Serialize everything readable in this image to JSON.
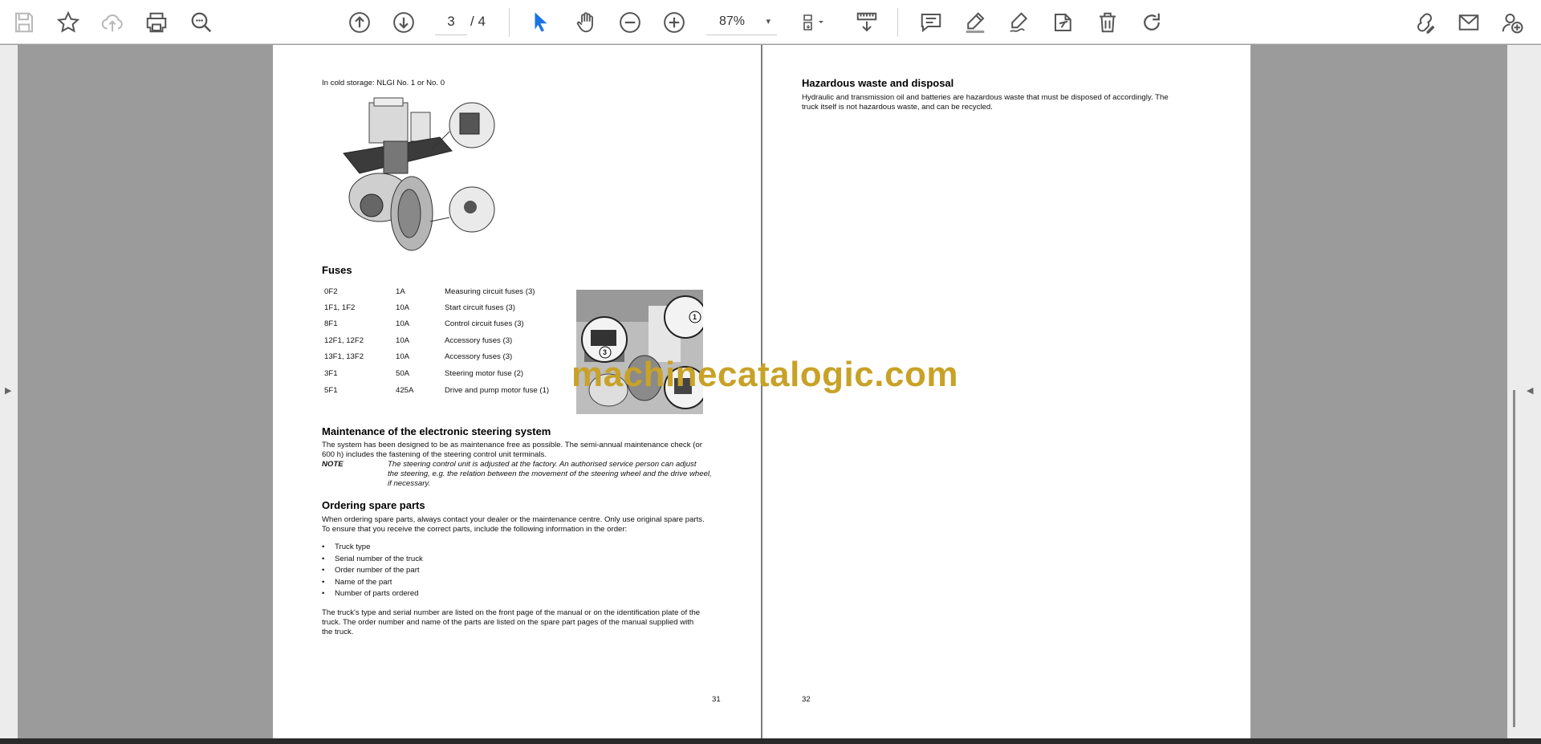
{
  "toolbar": {
    "page_current": "3",
    "page_total": "/ 4",
    "zoom": "87%",
    "zoom_caret": "▾"
  },
  "page_left": {
    "lubricant_line": "In cold storage: NLGI No. 1 or No. 0",
    "fuses_heading": "Fuses",
    "fuses": [
      [
        "0F2",
        "1A",
        "Measuring circuit fuses (3)"
      ],
      [
        "1F1, 1F2",
        "10A",
        "Start circuit fuses (3)"
      ],
      [
        "8F1",
        "10A",
        "Control circuit fuses (3)"
      ],
      [
        "12F1, 12F2",
        "10A",
        "Accessory fuses (3)"
      ],
      [
        "13F1, 13F2",
        "10A",
        "Accessory fuses (3)"
      ],
      [
        "3F1",
        "50A",
        "Steering motor fuse (2)"
      ],
      [
        "5F1",
        "425A",
        "Drive and pump motor fuse (1)"
      ]
    ],
    "callouts": [
      "1",
      "3"
    ],
    "steering_heading": "Maintenance of the electronic steering system",
    "steering_text_1": "The system has been designed to be as maintenance free as possible. The semi-annual maintenance check (or",
    "steering_text_2": "600 h) includes the fastening of the steering control unit terminals.",
    "note_label": "NOTE",
    "note_1": "The steering control unit is adjusted at the factory. An authorised service person can adjust",
    "note_2": "the steering, e.g. the relation between the movement of the steering wheel and the drive wheel,",
    "note_3": "if necessary.",
    "spare_heading": "Ordering spare parts",
    "spare_text_1": "When ordering spare parts, always contact your dealer or the maintenance centre. Only use original spare parts.",
    "spare_text_2": "To ensure that you receive the correct parts, include the following information in the order:",
    "bullet": "•",
    "bullets": [
      "Truck type",
      "Serial number of the truck",
      "Order number of the part",
      "Name of the part",
      "Number of parts ordered"
    ],
    "closing_1": "The truck's type and serial number are listed on the front page of the manual or on the identification plate of the",
    "closing_2": "truck. The order number and name of the parts are listed on the spare part pages of the manual supplied with",
    "closing_3": "the truck.",
    "page_number": "31"
  },
  "page_right": {
    "heading": "Hazardous waste and disposal",
    "text_1": "Hydraulic and transmission oil and batteries are hazardous waste that must be disposed of accordingly. The",
    "text_2": "truck itself is not hazardous waste, and can be recycled.",
    "page_number": "32"
  },
  "watermark": "machinecatalogic.com",
  "colors": {
    "toolbar_bg": "#ffffff",
    "viewer_bg": "#9b9b9b",
    "icon": "#555555",
    "selected_icon": "#1a73e8",
    "watermark": "#c8a227"
  },
  "icons": [
    "save-icon",
    "bookmark-star-icon",
    "upload-cloud-icon",
    "print-icon",
    "zoom-search-icon",
    "page-up-icon",
    "page-down-icon",
    "select-cursor-icon",
    "hand-pan-icon",
    "zoom-out-icon",
    "zoom-in-icon",
    "fit-page-icon",
    "scroll-mode-icon",
    "comment-icon",
    "highlight-icon",
    "draw-icon",
    "stamp-icon",
    "delete-icon",
    "redo-icon",
    "share-edit-icon",
    "email-icon",
    "add-user-icon"
  ]
}
